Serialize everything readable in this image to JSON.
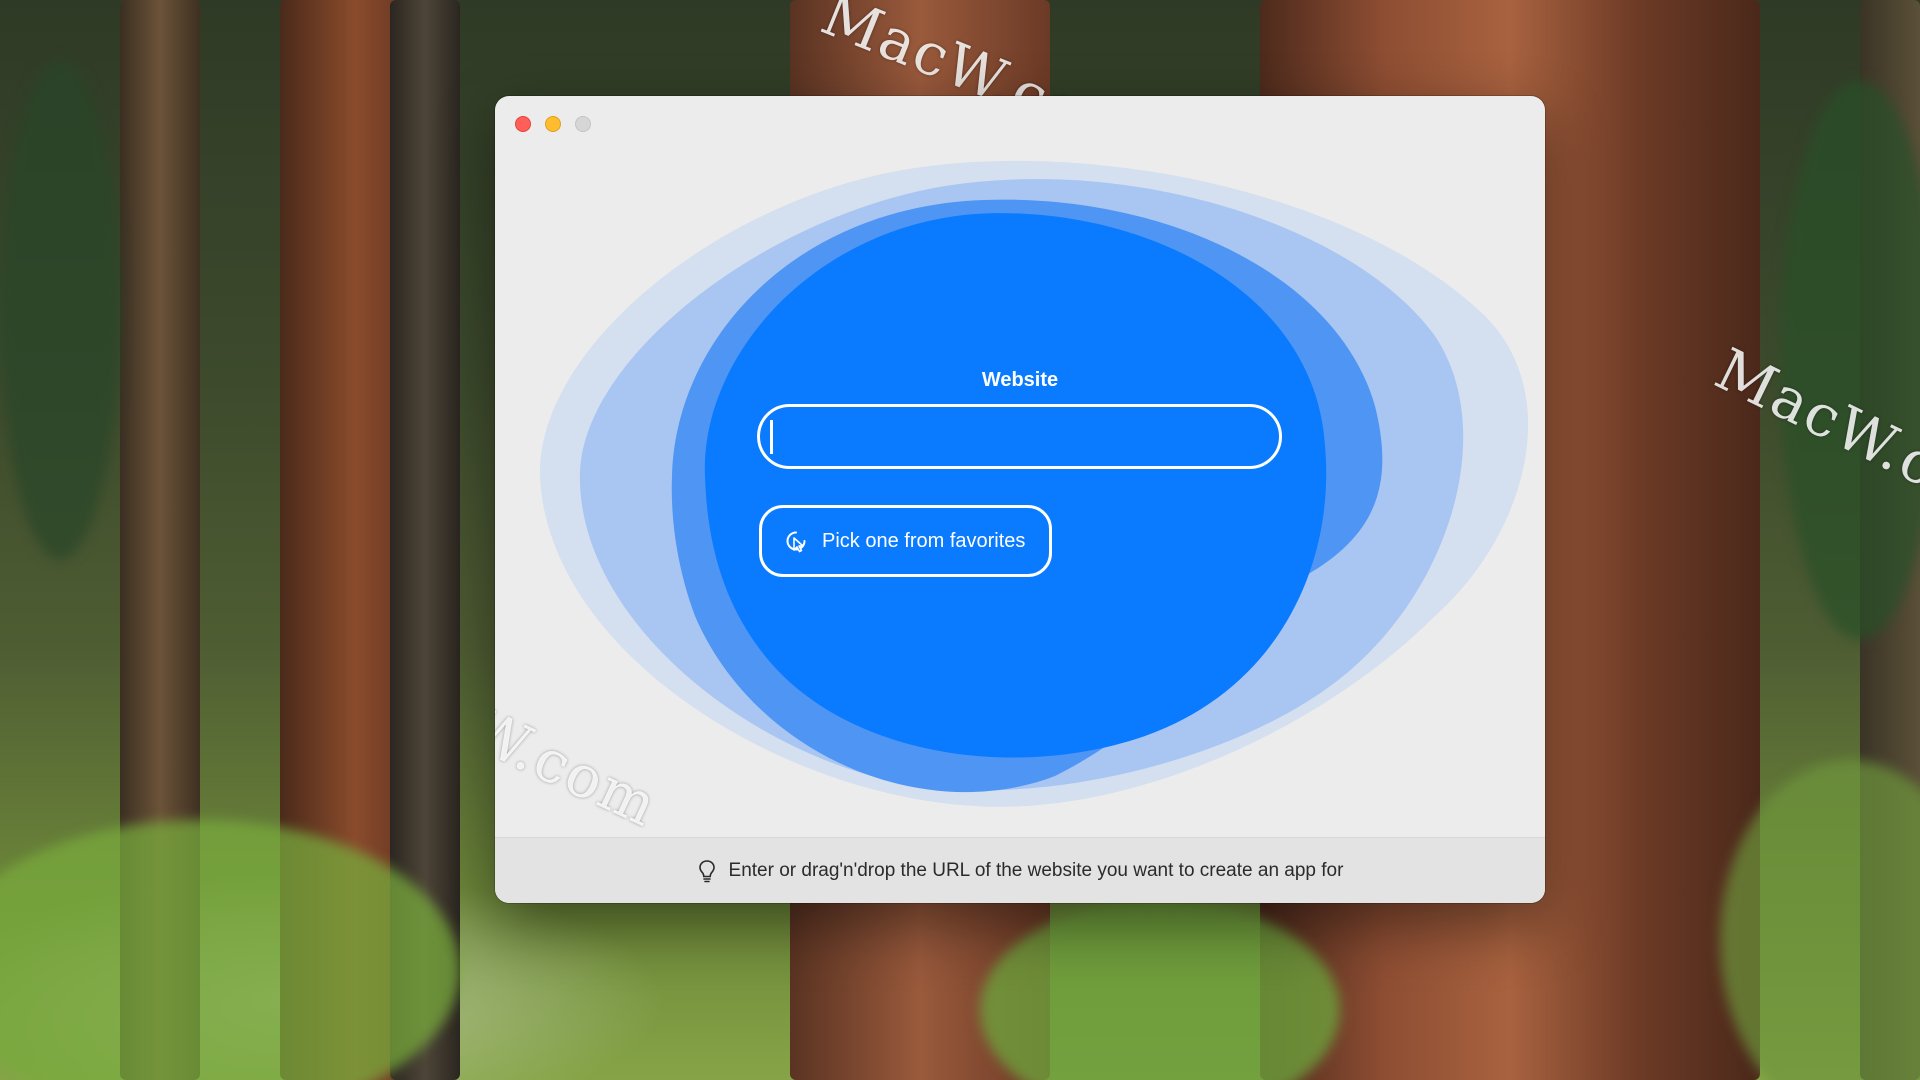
{
  "desktop": {
    "watermark_text": "MacW.com"
  },
  "window": {
    "controls": {
      "close": "close",
      "minimize": "minimize",
      "zoom": "zoom"
    },
    "website_label": "Website",
    "url_input": {
      "value": "",
      "placeholder": ""
    },
    "favorites_button_label": "Pick one from favorites",
    "favorites_icon": "pointer-click-icon",
    "footer": {
      "hint_icon": "lightbulb-icon",
      "hint_text": "Enter or drag'n'drop the URL of the website you want to create an app for"
    }
  },
  "colors": {
    "accent": "#0a7bff",
    "blob_mid": "#4f95f4",
    "blob_light": "#a9c6f2",
    "blob_faint": "#d4dff0",
    "window_bg": "#ececec",
    "footer_bg": "#e3e3e3"
  }
}
